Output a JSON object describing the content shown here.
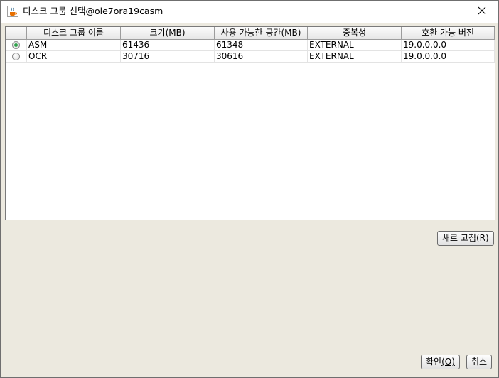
{
  "window": {
    "title": "디스크 그룹 선택@ole7ora19casm",
    "icons": {
      "app": "java-cup-icon",
      "close": "close-icon"
    }
  },
  "table": {
    "columns": [
      "",
      "디스크 그룹 이름",
      "크기(MB)",
      "사용 가능한 공간(MB)",
      "중복성",
      "호환 가능 버전"
    ],
    "rows": [
      {
        "selected": true,
        "name": "ASM",
        "size": "61436",
        "free": "61348",
        "redundancy": "EXTERNAL",
        "version": "19.0.0.0.0"
      },
      {
        "selected": false,
        "name": "OCR",
        "size": "30716",
        "free": "30616",
        "redundancy": "EXTERNAL",
        "version": "19.0.0.0.0"
      }
    ]
  },
  "buttons": {
    "refresh_label": "새로 고침",
    "refresh_mnemonic": "(R)",
    "ok_label": "확인",
    "ok_mnemonic": "(O)",
    "cancel_label": "취소"
  },
  "colors": {
    "radio_selected": "#2fa14a",
    "dialog_bg": "#ece9df"
  }
}
